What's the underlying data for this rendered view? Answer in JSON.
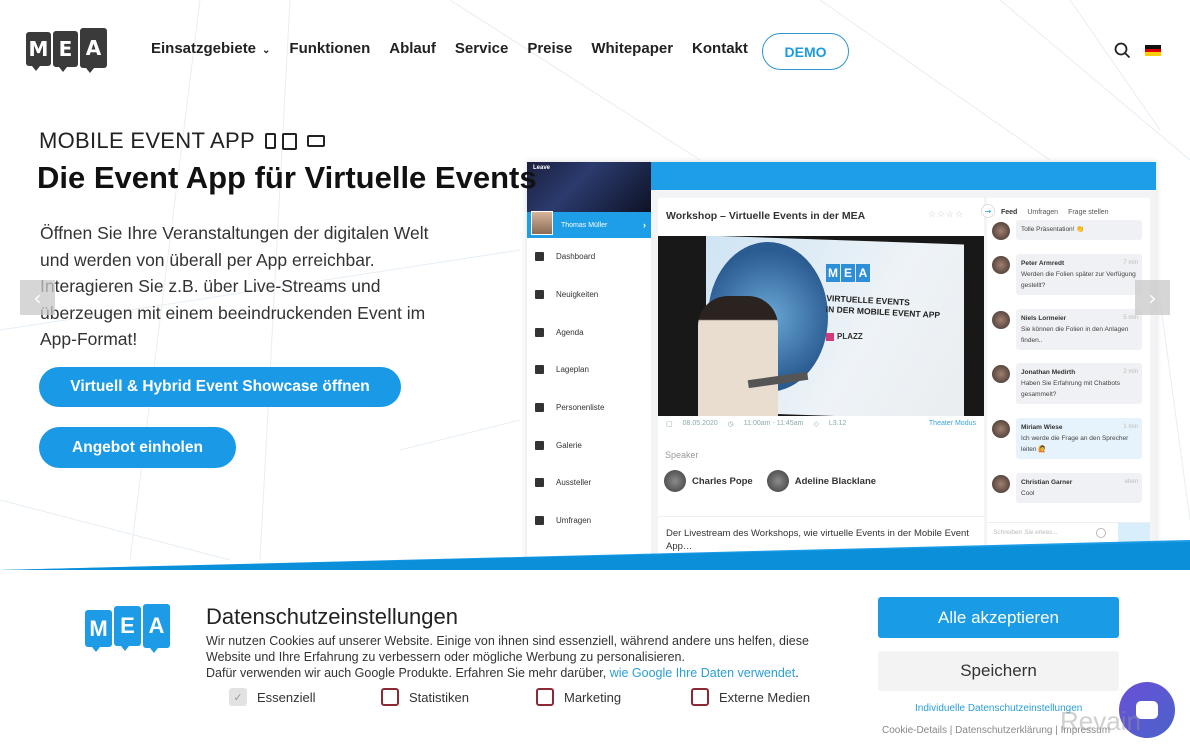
{
  "header": {
    "logo_letters": [
      "M",
      "E",
      "A"
    ],
    "nav": [
      {
        "label": "Einsatzgebiete",
        "dropdown": true
      },
      {
        "label": "Funktionen"
      },
      {
        "label": "Ablauf"
      },
      {
        "label": "Service"
      },
      {
        "label": "Preise"
      },
      {
        "label": "Whitepaper"
      },
      {
        "label": "Kontakt"
      }
    ],
    "dropdown_icon": "⌄",
    "demo_label": "DEMO",
    "search_icon": "search-icon",
    "language": "de"
  },
  "hero": {
    "subtitle": "MOBILE EVENT APP",
    "title": "Die Event App für Virtuelle Events",
    "text": "Öffnen Sie Ihre Veranstaltungen der digitalen Welt und werden von überall per App erreichbar. Interagieren Sie z.B. über Live-Streams und überzeugen mit einem beeindruckenden Event im App-Format!",
    "btn_showcase": "Virtuell & Hybrid Event Showcase öffnen",
    "btn_offer": "Angebot einholen",
    "prev_arrow": "‹",
    "next_arrow": "›"
  },
  "mockup": {
    "leave": "Leave",
    "user": "Thomas Müller",
    "menu": [
      "Dashboard",
      "Neuigkeiten",
      "Agenda",
      "Lageplan",
      "Personenliste",
      "Galerie",
      "Aussteller",
      "Umfragen"
    ],
    "session_title": "Workshop – Virtuelle Events in der MEA",
    "stars": "☆☆☆☆",
    "video_logo": [
      "M",
      "E",
      "A"
    ],
    "video_text_1": "VIRTUELLE EVENTS",
    "video_text_2": "IN DER MOBILE EVENT APP",
    "video_brand": "PLAZZ",
    "date": "08.05.2020",
    "time": "11:00am - 11:45am",
    "room": "L3.12",
    "theater": "Theater Modus",
    "speaker_heading": "Speaker",
    "speakers": [
      "Charles Pope",
      "Adeline Blacklane"
    ],
    "description": "Der Livestream des Workshops, wie virtuelle Events in der Mobile Event App…",
    "chat_tabs": [
      "Feed",
      "Umfragen",
      "Frage stellen"
    ],
    "messages": [
      {
        "name": "",
        "time": "",
        "text": "Tolle Präsentation! 👏"
      },
      {
        "name": "Peter Armredt",
        "time": "7 min",
        "text": "Werden die Folien später zur Verfügung gestellt?"
      },
      {
        "name": "Niels Lormeier",
        "time": "5 min",
        "text": "Sie können die Folien in den Anlagen finden.."
      },
      {
        "name": "Jonathan Medirth",
        "time": "2 min",
        "text": "Haben Sie Erfahrung mit Chatbots gesammelt?"
      },
      {
        "name": "Miriam Wiese",
        "time": "1 min",
        "text": "Ich werde die Frage an den Sprecher leiten 🙋"
      },
      {
        "name": "Christian Garner",
        "time": "eben",
        "text": "Cool"
      }
    ],
    "chat_placeholder": "Schreiben Sie etwas..."
  },
  "cookie": {
    "logo_letters": [
      "M",
      "E",
      "A"
    ],
    "title": "Datenschutzeinstellungen",
    "text_1": "Wir nutzen Cookies auf unserer Website. Einige von ihnen sind essenziell, während andere uns helfen, diese Website und Ihre Erfahrung zu verbessern oder mögliche Werbung zu personalisieren.",
    "text_2": "Dafür verwenden wir auch Google Produkte. Erfahren Sie mehr darüber, ",
    "link": "wie Google Ihre Daten verwendet",
    "text_3": ".",
    "options": [
      {
        "label": "Essenziell",
        "checked": true,
        "disabled": true
      },
      {
        "label": "Statistiken",
        "checked": false
      },
      {
        "label": "Marketing",
        "checked": false
      },
      {
        "label": "Externe Medien",
        "checked": false
      }
    ],
    "accept_all": "Alle akzeptieren",
    "save": "Speichern",
    "individual": "Individuelle Datenschutzeinstellungen",
    "footer_links": "Cookie-Details | Datenschutzerklärung | Impressum"
  },
  "watermark": "Revain",
  "colors": {
    "accent": "#1a9be6",
    "dark": "#3a3a3a",
    "checkbox_border": "#8b2a35"
  }
}
